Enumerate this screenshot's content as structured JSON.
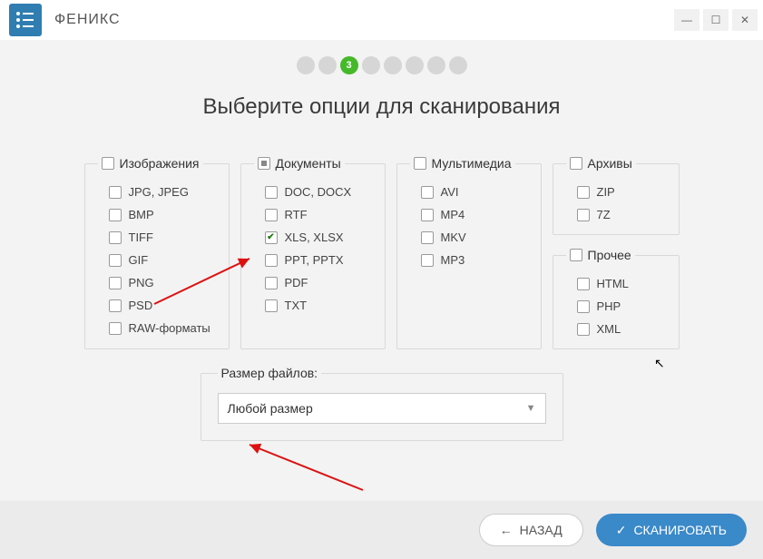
{
  "app_title": "ФЕНИКС",
  "page_title": "Выберите опции для сканирования",
  "stepper": {
    "total": 8,
    "current": 3
  },
  "groups": {
    "images": {
      "label": "Изображения",
      "state": "none",
      "items": [
        "JPG, JPEG",
        "BMP",
        "TIFF",
        "GIF",
        "PNG",
        "PSD",
        "RAW-форматы"
      ]
    },
    "documents": {
      "label": "Документы",
      "state": "partial",
      "items": [
        "DOC, DOCX",
        "RTF",
        "XLS, XLSX",
        "PPT, PPTX",
        "PDF",
        "TXT"
      ],
      "checked": [
        2
      ]
    },
    "multimedia": {
      "label": "Мультимедиа",
      "state": "none",
      "items": [
        "AVI",
        "MP4",
        "MKV",
        "MP3"
      ]
    },
    "archives": {
      "label": "Архивы",
      "state": "none",
      "items": [
        "ZIP",
        "7Z"
      ]
    },
    "other": {
      "label": "Прочее",
      "state": "none",
      "items": [
        "HTML",
        "PHP",
        "XML"
      ]
    }
  },
  "filesize": {
    "label": "Размер файлов:",
    "value": "Любой размер"
  },
  "buttons": {
    "back": "НАЗАД",
    "scan": "СКАНИРОВАТЬ"
  }
}
